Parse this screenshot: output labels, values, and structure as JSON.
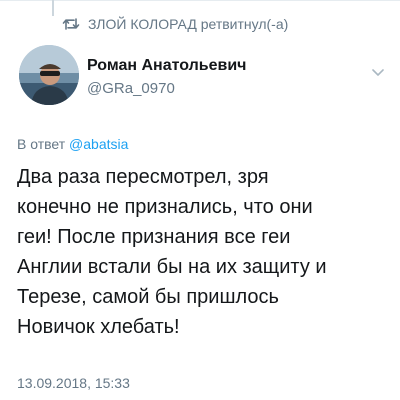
{
  "retweet": {
    "icon": "retweet-icon",
    "text": "ЗЛОЙ КОЛОРАД ретвитнул(-а)"
  },
  "author": {
    "display_name": "Роман Анатольевич",
    "handle": "@GRa_0970",
    "avatar_icon": "avatar-photo"
  },
  "menu": {
    "icon": "chevron-down-icon"
  },
  "reply": {
    "prefix": "В ответ",
    "mention": "@abatsia"
  },
  "tweet": {
    "lines": [
      "Два раза пересмотрел, зря",
      "конечно не признались, что они",
      "геи! После признания все геи",
      "Англии встали бы на их защиту и",
      "Терезе, самой бы пришлось",
      "Новичок хлебать!"
    ]
  },
  "timestamp": "13.09.2018, 15:33",
  "colors": {
    "text_primary": "#14171a",
    "text_secondary": "#657786",
    "link": "#1da1f2",
    "divider": "#e6ecf0"
  }
}
